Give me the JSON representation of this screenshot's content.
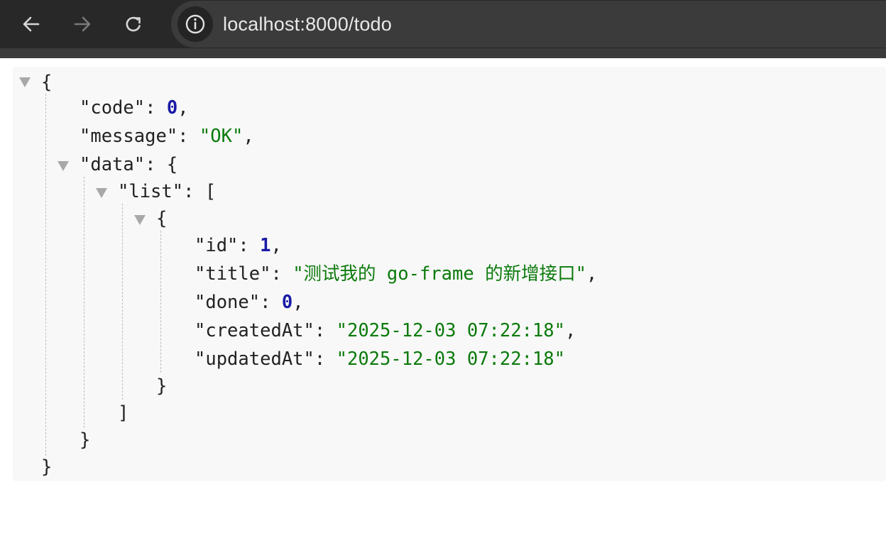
{
  "browser": {
    "url": "localhost:8000/todo",
    "icons": {
      "back": "arrow-left-icon",
      "forward": "arrow-right-icon",
      "reload": "reload-icon",
      "site_info": "info-circle-icon",
      "collapse": "triangle-down-icon"
    }
  },
  "json": {
    "open_brace": "{",
    "close_brace": "}",
    "open_bracket": "[",
    "close_bracket": "]",
    "code": {
      "key": "\"code\"",
      "value": "0"
    },
    "message": {
      "key": "\"message\"",
      "value": "\"OK\""
    },
    "data": {
      "key": "\"data\""
    },
    "list": {
      "key": "\"list\""
    },
    "item": {
      "id": {
        "key": "\"id\"",
        "value": "1"
      },
      "title": {
        "key": "\"title\"",
        "value": "\"测试我的 go-frame 的新增接口\""
      },
      "done": {
        "key": "\"done\"",
        "value": "0"
      },
      "createdAt": {
        "key": "\"createdAt\"",
        "value": "\"2025-12-03 07:22:18\""
      },
      "updatedAt": {
        "key": "\"updatedAt\"",
        "value": "\"2025-12-03 07:22:18\""
      }
    }
  },
  "colors": {
    "toolbar_bg": "#282828",
    "viewer_bg": "#f8f8f8",
    "number": "#1a1aa6",
    "string": "#0b7a0b"
  }
}
